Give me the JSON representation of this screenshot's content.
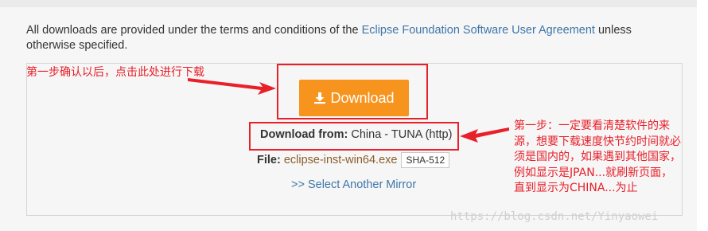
{
  "terms": {
    "prefix": "All downloads are provided under the terms and conditions of the ",
    "link": "Eclipse Foundation Software User Agreement",
    "suffix": " unless otherwise specified."
  },
  "download": {
    "button_label": "Download",
    "button_icon": "download-icon",
    "from_label": "Download from:",
    "from_value": "China - TUNA (http)",
    "file_label": "File:",
    "file_name": "eclipse-inst-win64.exe",
    "checksum_label": "SHA-512",
    "mirror_link": ">> Select Another Mirror"
  },
  "annotations": {
    "left_note": "第一步确认以后，点击此处进行下载",
    "right_note_lines": [
      "第一步：一定要看清楚软件的来",
      "源，想要下载速度快节约时间就必",
      "须是国内的，如果遇到其他国家，",
      "例如显示是JPAN...就刷新页面，",
      "直到显示为CHINA...为止"
    ],
    "highlight_color": "#e8202a"
  },
  "watermark": "https://blog.csdn.net/Yinyaowei",
  "colors": {
    "button": "#f7941e",
    "link": "#3e76a9",
    "file_link": "#8b5e2a"
  }
}
